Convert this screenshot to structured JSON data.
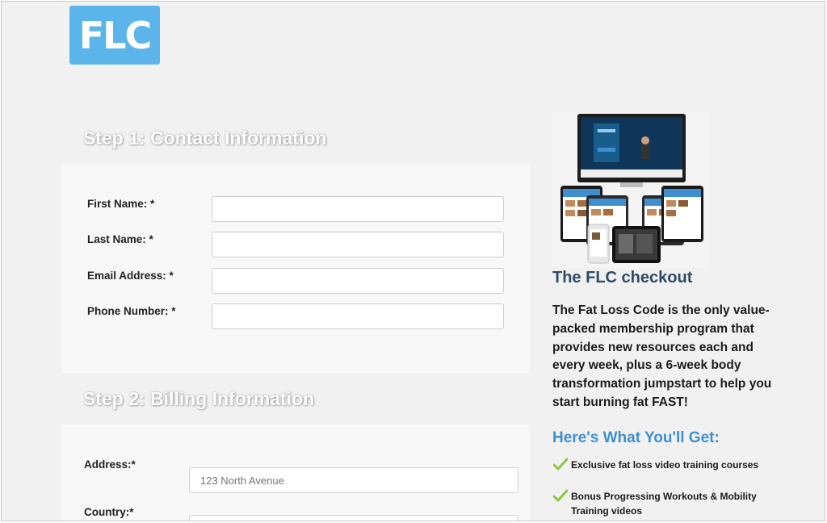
{
  "logo": {
    "text": "FLC",
    "color": "#5cb5ea"
  },
  "step1": {
    "title": "Step 1: Contact Information",
    "fields": [
      {
        "label": "First Name: *",
        "value": ""
      },
      {
        "label": "Last Name: *",
        "value": ""
      },
      {
        "label": "Email Address: *",
        "value": ""
      },
      {
        "label": "Phone Number: *",
        "value": ""
      }
    ]
  },
  "step2": {
    "title": "Step 2: Billing Information",
    "fields": [
      {
        "label": "Address:*",
        "placeholder": "123 North Avenue"
      },
      {
        "label": "Country:*",
        "value": ""
      }
    ]
  },
  "sidebar": {
    "image_icon": "multi-device-product-image",
    "title": "The FLC checkout",
    "description": "The Fat Loss Code is the only value-packed membership program that provides new resources each and every week, plus a 6-week body transformation jumpstart to help you start burning fat FAST!",
    "benefits_title": "Here's What You'll Get:",
    "benefits": [
      "Exclusive fat loss video training courses",
      "Bonus Progressing Workouts & Mobility Training videos"
    ],
    "check_color": "#8cc63f"
  }
}
